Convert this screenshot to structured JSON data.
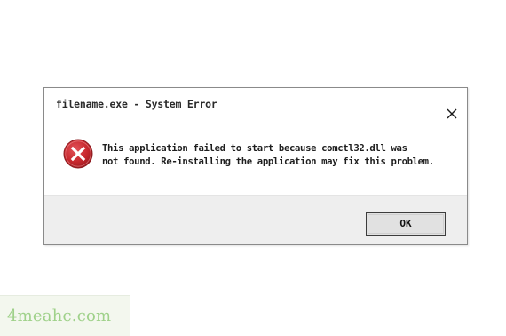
{
  "dialog": {
    "title": "filename.exe - System Error",
    "message_line1": "This application failed to start because comctl32.dll was",
    "message_line2": "not found. Re-installing the application may fix this problem.",
    "ok_label": "OK",
    "icons": {
      "close": "close-icon",
      "error": "error-icon"
    },
    "colors": {
      "error_red": "#c8282e",
      "footer_bg": "#eeeeee"
    }
  },
  "watermark": {
    "text": "4meahc.com"
  }
}
